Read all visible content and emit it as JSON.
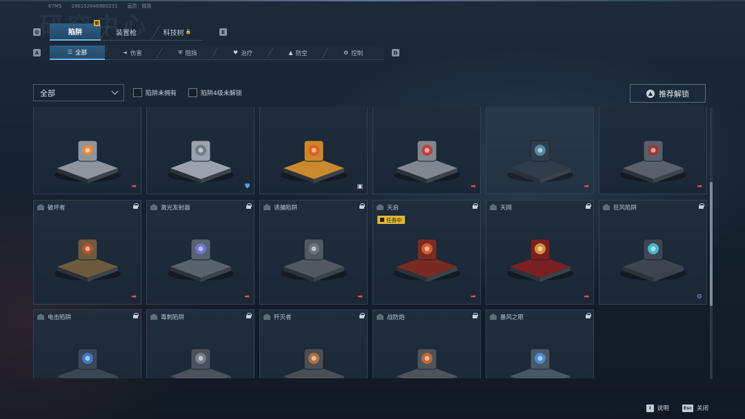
{
  "header": {
    "watermark": "研究中心",
    "fps": "67MS",
    "uid": "2861526469B0231",
    "quality": "画质：精致"
  },
  "tabs": {
    "prev_key": "Q",
    "next_key": "E",
    "items": [
      {
        "label": "陷阱",
        "badge": "新"
      },
      {
        "label": "装置枪"
      },
      {
        "label": "科技树"
      }
    ]
  },
  "subtabs": {
    "prev_key": "A",
    "next_key": "D",
    "items": [
      {
        "label": "全部",
        "icon": "list-icon"
      },
      {
        "label": "伤害",
        "icon": "damage-icon"
      },
      {
        "label": "阻挡",
        "icon": "shield-icon"
      },
      {
        "label": "治疗",
        "icon": "heal-icon"
      },
      {
        "label": "防空",
        "icon": "anti-air-icon"
      },
      {
        "label": "控制",
        "icon": "gear-icon"
      }
    ]
  },
  "filters": {
    "dropdown_value": "全部",
    "check1": "陷阱未拥有",
    "check2": "陷阱4级未解锁",
    "recommend": "推荐解锁"
  },
  "cards": [
    {
      "name": "",
      "locked": false,
      "role": "damage",
      "highlight": false
    },
    {
      "name": "",
      "locked": false,
      "role": "block",
      "highlight": false
    },
    {
      "name": "",
      "locked": false,
      "role": "support",
      "highlight": false
    },
    {
      "name": "",
      "locked": false,
      "role": "damage",
      "highlight": false
    },
    {
      "name": "",
      "locked": false,
      "role": "damage",
      "highlight": true
    },
    {
      "name": "",
      "locked": false,
      "role": "damage",
      "highlight": false
    },
    {
      "name": "破坏者",
      "locked": true,
      "role": "damage"
    },
    {
      "name": "激光发射器",
      "locked": true,
      "role": "damage"
    },
    {
      "name": "诱捕陷阱",
      "locked": true,
      "role": "damage"
    },
    {
      "name": "天启",
      "locked": true,
      "role": "damage",
      "mission": "任务中"
    },
    {
      "name": "天网",
      "locked": true,
      "role": "damage"
    },
    {
      "name": "狂风陷阱",
      "locked": true,
      "role": "control"
    },
    {
      "name": "电击陷阱",
      "locked": true,
      "role": ""
    },
    {
      "name": "毒刺陷阱",
      "locked": true,
      "role": ""
    },
    {
      "name": "歼灭者",
      "locked": true,
      "role": ""
    },
    {
      "name": "战防炮",
      "locked": true,
      "role": ""
    },
    {
      "name": "暴风之眼",
      "locked": true,
      "role": ""
    }
  ],
  "footer": {
    "help_key": "I",
    "help_label": "说明",
    "close_key": "Esc",
    "close_label": "关闭"
  },
  "colors": {
    "accent": "#6fb3e8",
    "damage": "#e0505a",
    "block": "#4fa3e0",
    "support": "#d8dee4",
    "control": "#9b8be0",
    "mission": "#e2b53a"
  }
}
